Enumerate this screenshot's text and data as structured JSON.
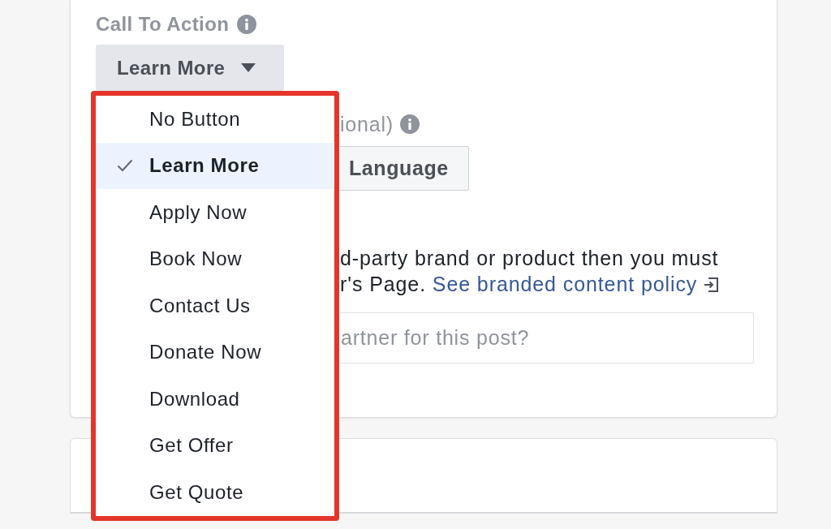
{
  "call_to_action": {
    "label": "Call To Action",
    "value": "Learn More",
    "expanded": true,
    "highlighted": true,
    "options": [
      {
        "label": "No Button",
        "selected": false
      },
      {
        "label": "Learn More",
        "selected": true
      },
      {
        "label": "Apply Now",
        "selected": false
      },
      {
        "label": "Book Now",
        "selected": false
      },
      {
        "label": "Contact Us",
        "selected": false
      },
      {
        "label": "Donate Now",
        "selected": false
      },
      {
        "label": "Download",
        "selected": false
      },
      {
        "label": "Get Offer",
        "selected": false
      },
      {
        "label": "Get Quote",
        "selected": false
      }
    ]
  },
  "language": {
    "label": "ional)",
    "button": "Language"
  },
  "branded_content": {
    "lines": [
      "d-party brand or product then you must",
      "r's Page."
    ],
    "link": "See branded content policy"
  },
  "partner_field": {
    "placeholder": "artner for this post?"
  }
}
